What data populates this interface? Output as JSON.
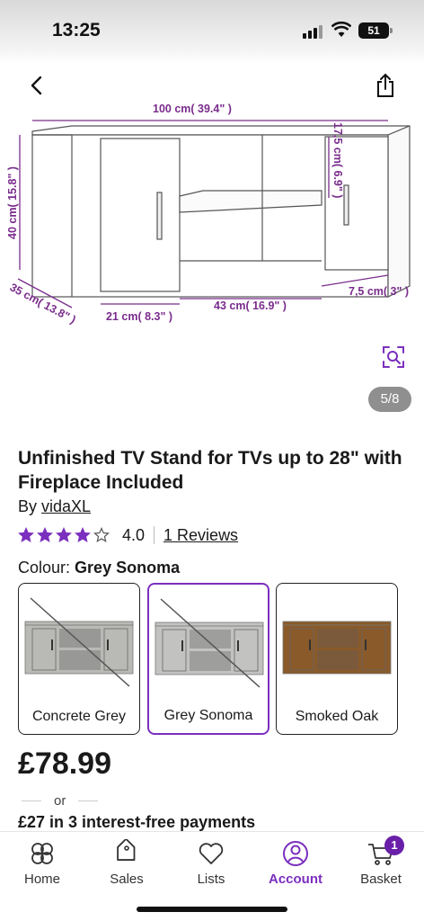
{
  "status_bar": {
    "time": "13:25",
    "battery": "51"
  },
  "gallery": {
    "counter": "5/8",
    "dimensions": {
      "width": "100 cm( 39.4\" )",
      "height": "40 cm( 15.8\" )",
      "depth": "35 cm( 13.8\" )",
      "inner_height": "17,5 cm( 6.9\" )",
      "left_section": "21 cm( 8.3\" )",
      "middle_section": "43 cm( 16.9\" )",
      "right_section": "7,5 cm( 3\" )"
    }
  },
  "product": {
    "title": "Unfinished TV Stand for TVs up to 28\" with Fireplace Included",
    "by_prefix": "By",
    "brand": "vidaXL",
    "rating": {
      "stars": 4,
      "out_of": 5,
      "value": "4.0",
      "reviews_label": "1 Reviews"
    },
    "colour_label": "Colour:",
    "colour_selected": "Grey Sonoma",
    "swatches": [
      {
        "label": "Concrete Grey",
        "color": "#b9b9b6",
        "unavailable": true,
        "selected": false
      },
      {
        "label": "Grey Sonoma",
        "color": "#c2c2c0",
        "unavailable": true,
        "selected": true
      },
      {
        "label": "Smoked Oak",
        "color": "#8a5a2a",
        "unavailable": false,
        "selected": false
      }
    ],
    "price": "£78.99",
    "or_text": "or",
    "instalments": "£27 in 3 interest-free payments"
  },
  "tabbar": {
    "items": [
      {
        "label": "Home",
        "icon": "home-icon",
        "active": false
      },
      {
        "label": "Sales",
        "icon": "tag-icon",
        "active": false
      },
      {
        "label": "Lists",
        "icon": "heart-icon",
        "active": false
      },
      {
        "label": "Account",
        "icon": "account-icon",
        "active": true
      },
      {
        "label": "Basket",
        "icon": "basket-icon",
        "active": false,
        "badge": "1"
      }
    ]
  },
  "colors": {
    "accent": "#7b2fbe",
    "dimension": "#7a2c8c",
    "text": "#1a1a1a"
  }
}
